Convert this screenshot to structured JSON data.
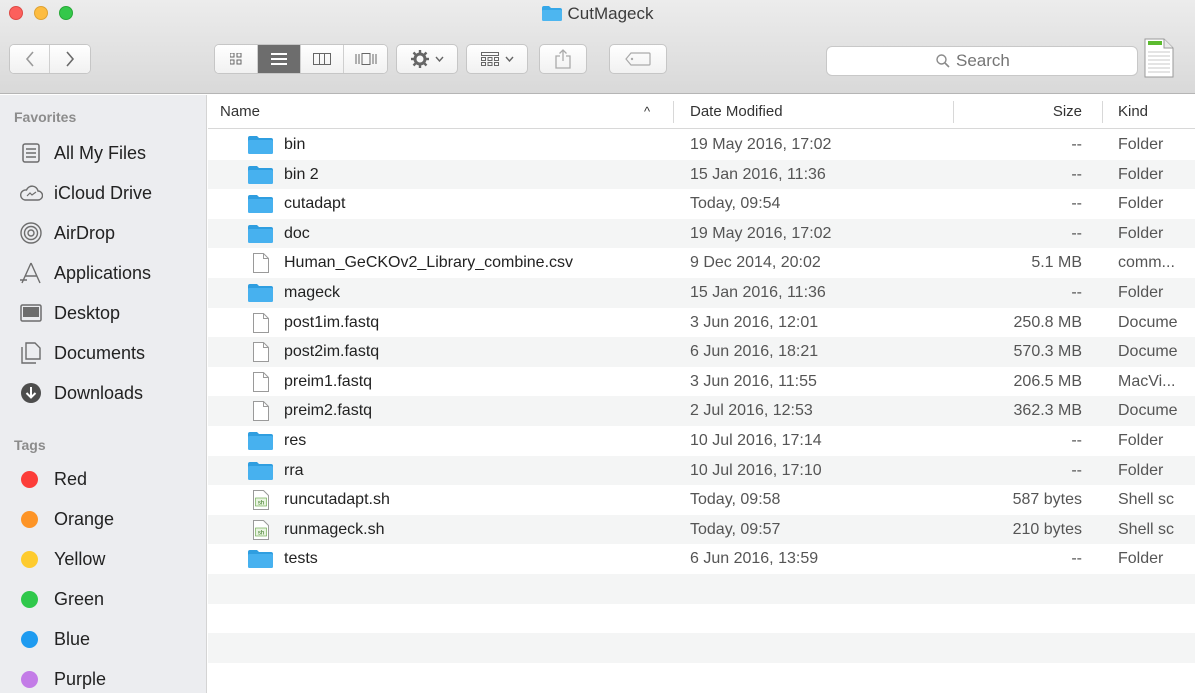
{
  "window": {
    "title": "CutMageck"
  },
  "toolbar": {
    "search_placeholder": "Search",
    "views": [
      "icon-view",
      "list-view",
      "column-view",
      "cover-flow-view"
    ],
    "active_view": "list-view",
    "colors": {
      "active_segment": "#6d6d6d",
      "folder_blue": "#35a7e8"
    }
  },
  "sidebar": {
    "favorites_heading": "Favorites",
    "favorites": [
      {
        "label": "All My Files",
        "icon": "all-files-icon"
      },
      {
        "label": "iCloud Drive",
        "icon": "cloud-icon"
      },
      {
        "label": "AirDrop",
        "icon": "airdrop-icon"
      },
      {
        "label": "Applications",
        "icon": "applications-icon"
      },
      {
        "label": "Desktop",
        "icon": "desktop-icon"
      },
      {
        "label": "Documents",
        "icon": "documents-icon"
      },
      {
        "label": "Downloads",
        "icon": "downloads-icon"
      }
    ],
    "tags_heading": "Tags",
    "tags": [
      {
        "label": "Red",
        "color": "#fc3d39"
      },
      {
        "label": "Orange",
        "color": "#fd9426"
      },
      {
        "label": "Yellow",
        "color": "#fecb2e"
      },
      {
        "label": "Green",
        "color": "#2fc84b"
      },
      {
        "label": "Blue",
        "color": "#1e9bf0"
      },
      {
        "label": "Purple",
        "color": "#c37ce7"
      }
    ]
  },
  "list": {
    "columns": {
      "name": "Name",
      "date": "Date Modified",
      "size": "Size",
      "kind": "Kind"
    },
    "sort_indicator": "^",
    "rows": [
      {
        "name": "bin",
        "date": "19 May 2016, 17:02",
        "size": "--",
        "kind": "Folder",
        "type": "folder"
      },
      {
        "name": "bin 2",
        "date": "15 Jan 2016, 11:36",
        "size": "--",
        "kind": "Folder",
        "type": "folder"
      },
      {
        "name": "cutadapt",
        "date": "Today, 09:54",
        "size": "--",
        "kind": "Folder",
        "type": "folder"
      },
      {
        "name": "doc",
        "date": "19 May 2016, 17:02",
        "size": "--",
        "kind": "Folder",
        "type": "folder"
      },
      {
        "name": "Human_GeCKOv2_Library_combine.csv",
        "date": "9 Dec 2014, 20:02",
        "size": "5.1 MB",
        "kind": "comm...",
        "type": "file"
      },
      {
        "name": "mageck",
        "date": "15 Jan 2016, 11:36",
        "size": "--",
        "kind": "Folder",
        "type": "folder"
      },
      {
        "name": "post1im.fastq",
        "date": "3 Jun 2016, 12:01",
        "size": "250.8 MB",
        "kind": "Docume",
        "type": "file"
      },
      {
        "name": "post2im.fastq",
        "date": "6 Jun 2016, 18:21",
        "size": "570.3 MB",
        "kind": "Docume",
        "type": "file"
      },
      {
        "name": "preim1.fastq",
        "date": "3 Jun 2016, 11:55",
        "size": "206.5 MB",
        "kind": "MacVi...",
        "type": "file"
      },
      {
        "name": "preim2.fastq",
        "date": "2 Jul 2016, 12:53",
        "size": "362.3 MB",
        "kind": "Docume",
        "type": "file"
      },
      {
        "name": "res",
        "date": "10 Jul 2016, 17:14",
        "size": "--",
        "kind": "Folder",
        "type": "folder"
      },
      {
        "name": "rra",
        "date": "10 Jul 2016, 17:10",
        "size": "--",
        "kind": "Folder",
        "type": "folder"
      },
      {
        "name": "runcutadapt.sh",
        "date": "Today, 09:58",
        "size": "587 bytes",
        "kind": "Shell sc",
        "type": "shell"
      },
      {
        "name": "runmageck.sh",
        "date": "Today, 09:57",
        "size": "210 bytes",
        "kind": "Shell sc",
        "type": "shell"
      },
      {
        "name": "tests",
        "date": "6 Jun 2016, 13:59",
        "size": "--",
        "kind": "Folder",
        "type": "folder"
      }
    ]
  }
}
